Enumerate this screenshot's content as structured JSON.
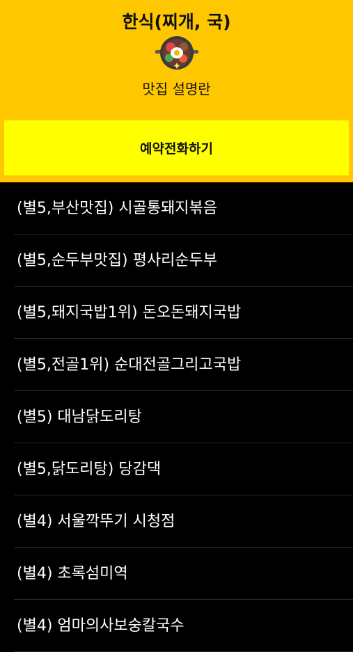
{
  "header": {
    "title": "한식(찌개, 국)",
    "subtitle": "맛집 설명란",
    "icon": "hotpot-icon",
    "background_color": "#FFC700"
  },
  "call_button": {
    "label": "예약전화하기",
    "background_color": "#FFFF00"
  },
  "restaurants": [
    {
      "label": "(별5,부산맛집) 시골통돼지볶음"
    },
    {
      "label": "(별5,순두부맛집) 평사리순두부"
    },
    {
      "label": "(별5,돼지국밥1위) 돈오돈돼지국밥"
    },
    {
      "label": "(별5,전골1위) 순대전골그리고국밥"
    },
    {
      "label": "(별5) 대남닭도리탕"
    },
    {
      "label": "(별5,닭도리탕) 당감댁"
    },
    {
      "label": "(별4) 서울깍뚜기 시청점"
    },
    {
      "label": "(별4) 초록섬미역"
    },
    {
      "label": "(별4) 엄마의사보숭칼국수"
    }
  ]
}
